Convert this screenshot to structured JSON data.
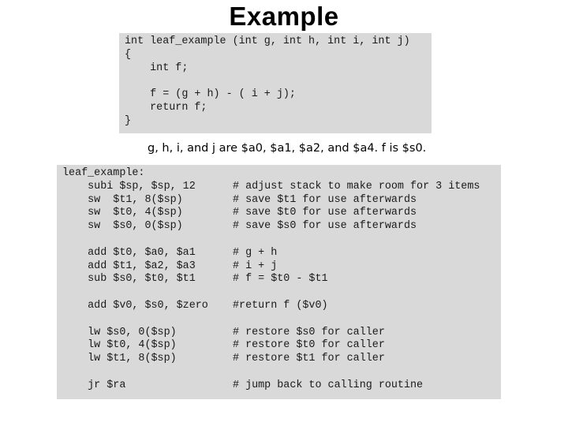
{
  "title": "Example",
  "c_code": {
    "lines": [
      "int leaf_example (int g, int h, int i, int j)",
      "{",
      "    int f;",
      "",
      "    f = (g + h) - ( i + j);",
      "    return f;",
      "}"
    ]
  },
  "caption": "g, h, i, and j are $a0, $a1, $a2, and $a4. f is $s0.",
  "asm": {
    "lines": [
      {
        "code": "leaf_example:",
        "comment": ""
      },
      {
        "code": "    subi $sp, $sp, 12",
        "comment": "# adjust stack to make room for 3 items"
      },
      {
        "code": "    sw  $t1, 8($sp)",
        "comment": "# save $t1 for use afterwards"
      },
      {
        "code": "    sw  $t0, 4($sp)",
        "comment": "# save $t0 for use afterwards"
      },
      {
        "code": "    sw  $s0, 0($sp)",
        "comment": "# save $s0 for use afterwards"
      },
      {
        "code": "",
        "comment": ""
      },
      {
        "code": "    add $t0, $a0, $a1",
        "comment": "# g + h"
      },
      {
        "code": "    add $t1, $a2, $a3",
        "comment": "# i + j"
      },
      {
        "code": "    sub $s0, $t0, $t1",
        "comment": "# f = $t0 - $t1"
      },
      {
        "code": "",
        "comment": ""
      },
      {
        "code": "    add $v0, $s0, $zero",
        "comment": "#return f ($v0)"
      },
      {
        "code": "",
        "comment": ""
      },
      {
        "code": "    lw $s0, 0($sp)",
        "comment": "# restore $s0 for caller"
      },
      {
        "code": "    lw $t0, 4($sp)",
        "comment": "# restore $t0 for caller"
      },
      {
        "code": "    lw $t1, 8($sp)",
        "comment": "# restore $t1 for caller"
      },
      {
        "code": "",
        "comment": ""
      },
      {
        "code": "    jr $ra",
        "comment": "# jump back to calling routine"
      }
    ]
  }
}
